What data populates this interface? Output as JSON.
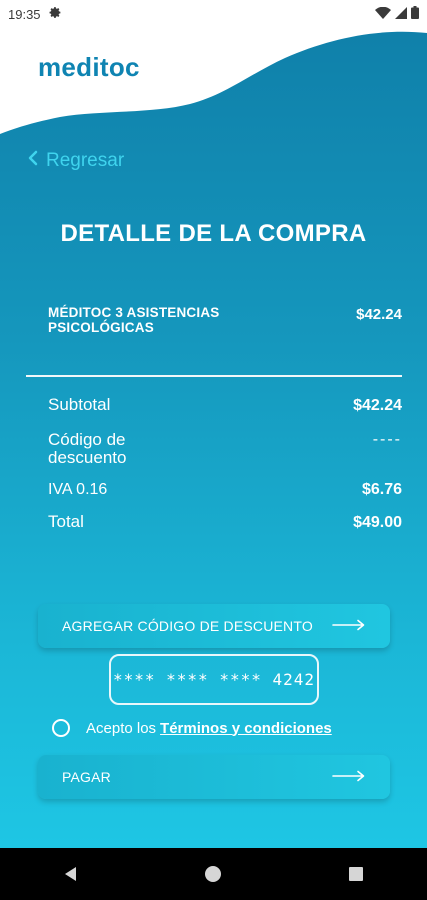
{
  "status": {
    "time": "19:35"
  },
  "brand": {
    "logo": "meditoc"
  },
  "nav": {
    "back_label": "Regresar"
  },
  "page": {
    "title": "DETALLE DE LA COMPRA"
  },
  "product": {
    "name": "MÉDITOC 3 ASISTENCIAS PSICOLÓGICAS",
    "price": "$42.24"
  },
  "summary": [
    {
      "label": "Subtotal",
      "value": "$42.24"
    },
    {
      "label": "Código de descuento",
      "value": "----"
    },
    {
      "label": "IVA 0.16",
      "value": "$6.76"
    },
    {
      "label": "Total",
      "value": "$49.00"
    }
  ],
  "actions": {
    "discount_label": "AGREGAR CÓDIGO DE DESCUENTO",
    "pay_label": "PAGAR"
  },
  "card": {
    "masked_number": "**** **** **** 4242"
  },
  "terms": {
    "prefix": "Acepto los",
    "link": "Términos y condiciones"
  },
  "colors": {
    "brand": "#0f84b2",
    "accent": "#3fd4ee",
    "button": "#20c6e0"
  },
  "icons": {
    "status": [
      "gear-icon",
      "wifi-icon",
      "signal-icon",
      "battery-icon"
    ],
    "system_nav": [
      "back-triangle-icon",
      "home-circle-icon",
      "recents-square-icon"
    ]
  }
}
